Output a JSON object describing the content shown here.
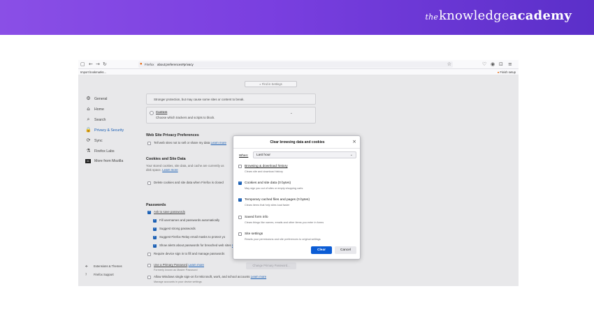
{
  "banner": {
    "brand_prefix": "the",
    "brand_main": "knowledge",
    "brand_bold": "academy"
  },
  "browser": {
    "identity_label": "Firefox",
    "url": "about:preferences#privacy",
    "bookmarks_left": "Import bookmarks...",
    "bookmarks_right": "Finish setup",
    "find_placeholder": "Find in Settings"
  },
  "sidebar": {
    "items": [
      {
        "label": "General",
        "icon": "gear-icon"
      },
      {
        "label": "Home",
        "icon": "home-icon"
      },
      {
        "label": "Search",
        "icon": "search-icon"
      },
      {
        "label": "Privacy & Security",
        "icon": "lock-icon"
      },
      {
        "label": "Sync",
        "icon": "sync-icon"
      },
      {
        "label": "Firefox Labs",
        "icon": "labs-icon"
      },
      {
        "label": "More from Mozilla",
        "icon": "mozilla-icon"
      }
    ],
    "footer": [
      {
        "label": "Extensions & Themes",
        "icon": "puzzle-icon"
      },
      {
        "label": "Firefox Support",
        "icon": "help-icon"
      }
    ]
  },
  "privacy": {
    "strict_desc": "Stronger protection, but may cause some sites or content to break.",
    "custom_label": "Custom",
    "custom_desc": "Choose which trackers and scripts to block.",
    "wsp_heading": "Web Site Privacy Preferences",
    "wsp_option": "Tell web sites not to sell or share my data",
    "learn_more": "Learn more",
    "cookies_heading": "Cookies and Site Data",
    "cookies_desc_1": "Your stored cookies, site data, and cache are currently us",
    "cookies_desc_2": "disk space.",
    "delete_on_close": "Delete cookies and site data when Firefox is closed",
    "passwords_heading": "Passwords",
    "ask_save": "Ask to save passwords",
    "fill_auto": "Fill usernames and passwords automatically",
    "suggest_strong": "Suggest strong passwords",
    "suggest_relay": "Suggest Firefox Relay email masks to protect yo",
    "show_alerts": "Show alerts about passwords for breached web sites",
    "require_device": "Require device sign in to fill and manage passwords",
    "primary_pw": "Use a Primary Password",
    "primary_pw_note": "Formerly known as Master Password",
    "change_primary": "Change Primary Password...",
    "windows_sso": "Allow Windows single sign-on for Microsoft, work, and school accounts",
    "windows_sso_note": "Manage accounts in your device settings"
  },
  "dialog": {
    "title": "Clear browsing data and cookies",
    "when_label": "When:",
    "when_value": "Last hour",
    "options": [
      {
        "label": "Browsing & download history",
        "desc": "Clears site and download history",
        "checked": false
      },
      {
        "label": "Cookies and site data (0 bytes)",
        "desc": "May sign you out of sites or empty shopping carts",
        "checked": true
      },
      {
        "label": "Temporary cached files and pages (0 bytes)",
        "desc": "Clears items that help sites load faster",
        "checked": true
      },
      {
        "label": "Saved form info",
        "desc": "Clears things like names, emails and other items you enter in forms",
        "checked": false
      },
      {
        "label": "Site settings",
        "desc": "Resets your permissions and site preferences to original settings",
        "checked": false
      }
    ],
    "clear_label": "Clear",
    "cancel_label": "Cancel"
  }
}
